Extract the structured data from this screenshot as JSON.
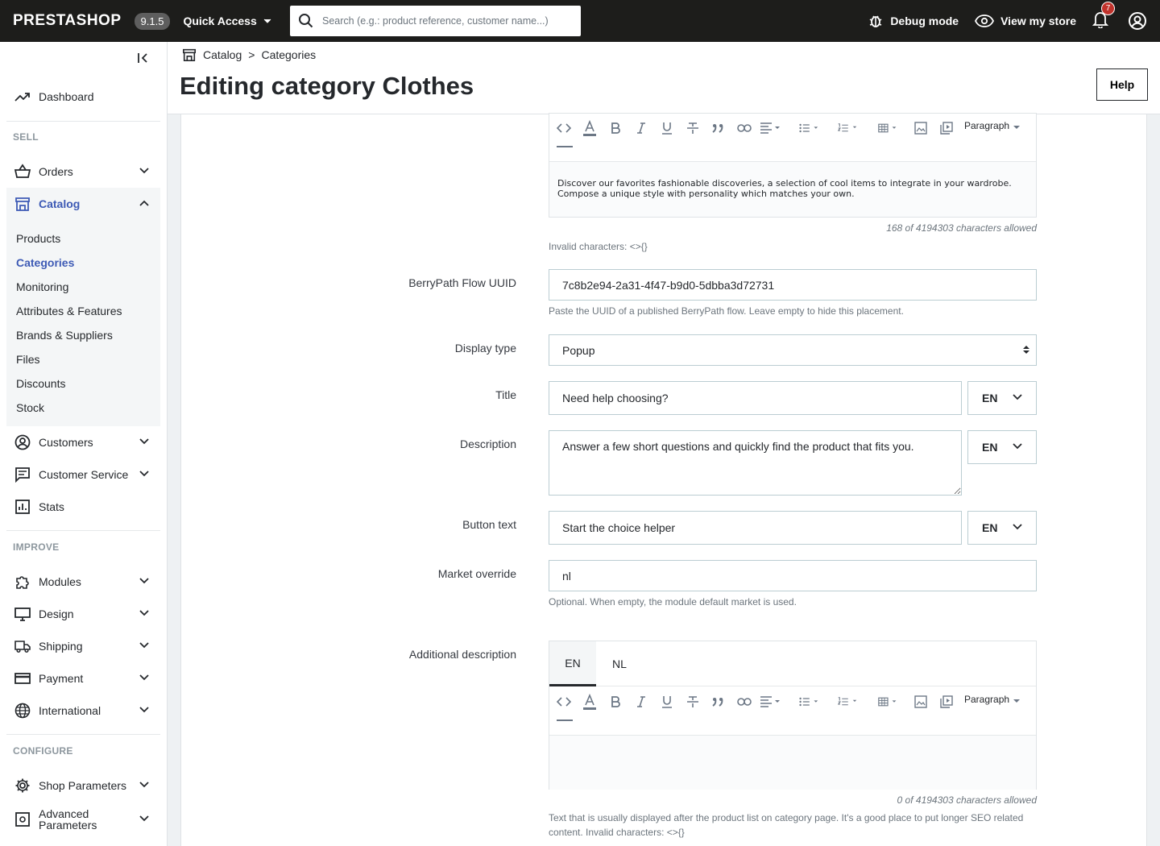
{
  "topbar": {
    "logo": "PRESTASHOP",
    "version": "9.1.5",
    "quick_access": "Quick Access",
    "search_placeholder": "Search (e.g.: product reference, customer name...)",
    "debug_mode": "Debug mode",
    "view_store": "View my store",
    "notifications_count": "7"
  },
  "sidebar": {
    "dashboard": "Dashboard",
    "sections": {
      "sell": "SELL",
      "improve": "IMPROVE",
      "configure": "CONFIGURE"
    },
    "orders": "Orders",
    "catalog": "Catalog",
    "catalog_items": [
      "Products",
      "Categories",
      "Monitoring",
      "Attributes & Features",
      "Brands & Suppliers",
      "Files",
      "Discounts",
      "Stock"
    ],
    "customers": "Customers",
    "customer_service": "Customer Service",
    "stats": "Stats",
    "modules": "Modules",
    "design": "Design",
    "shipping": "Shipping",
    "payment": "Payment",
    "international": "International",
    "shop_parameters": "Shop Parameters",
    "advanced_parameters": [
      "Advanced",
      "Parameters"
    ]
  },
  "header": {
    "breadcrumb": [
      "Catalog",
      "Categories"
    ],
    "breadcrumb_sep": ">",
    "title": "Editing category Clothes",
    "help": "Help"
  },
  "editor_toolbar": {
    "paragraph": "Paragraph"
  },
  "form": {
    "description_editor": {
      "text": "Discover our favorites fashionable discoveries, a selection of cool items to integrate in your wardrobe. Compose a unique style with personality which matches your own.",
      "counter": "168 of 4194303 characters allowed",
      "help": "Invalid characters: <>{}"
    },
    "uuid": {
      "label": "BerryPath Flow UUID",
      "value": "7c8b2e94-2a31-4f47-b9d0-5dbba3d72731",
      "help": "Paste the UUID of a published BerryPath flow. Leave empty to hide this placement."
    },
    "display_type": {
      "label": "Display type",
      "value": "Popup"
    },
    "title": {
      "label": "Title",
      "value": "Need help choosing?",
      "lang": "EN"
    },
    "description": {
      "label": "Description",
      "value": "Answer a few short questions and quickly find the product that fits you.",
      "lang": "EN"
    },
    "button_text": {
      "label": "Button text",
      "value": "Start the choice helper",
      "lang": "EN"
    },
    "market_override": {
      "label": "Market override",
      "value": "nl",
      "help": "Optional. When empty, the module default market is used."
    },
    "additional_description": {
      "label": "Additional description",
      "tabs": [
        "EN",
        "NL"
      ],
      "active_tab": "EN",
      "counter": "0 of 4194303 characters allowed",
      "help_line1": "Text that is usually displayed after the product list on category page. It's a good place to put longer SEO related",
      "help_line2": "content. Invalid characters: <>{}"
    }
  },
  "colors": {
    "topbar": "#1d1d1b",
    "accent": "#3d5ab5",
    "badge": "#c0322b"
  }
}
